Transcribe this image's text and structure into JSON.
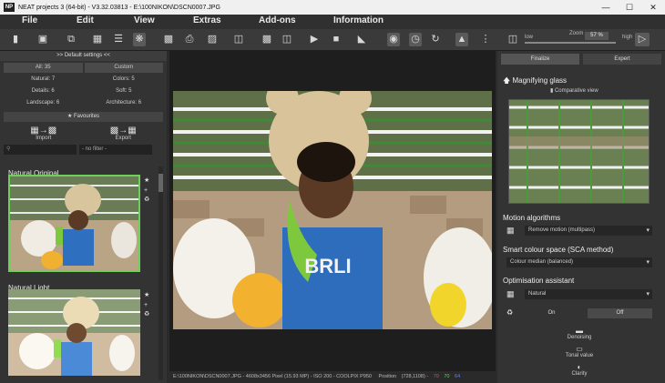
{
  "window": {
    "app_badge": "NP",
    "title": "NEAT projects 3 (64-bit) - V3.32.03813 - E:\\100NIKON\\DSCN0007.JPG",
    "controls": [
      "—",
      "☐",
      "✕"
    ]
  },
  "menu": [
    "File",
    "Edit",
    "View",
    "Extras",
    "Add-ons",
    "Information"
  ],
  "toolbar": {
    "zoom_label": "Zoom",
    "zoom_value": "57 %",
    "zoom_level": 0.57,
    "low_label": "low",
    "high_label": "high"
  },
  "left_panel": {
    "header": ">> Default settings <<",
    "filters": [
      {
        "label": "All: 35",
        "active": true
      },
      {
        "label": "Custom",
        "active": false
      },
      {
        "label": "Natural: 7"
      },
      {
        "label": "Colors: 5"
      },
      {
        "label": "Details: 6"
      },
      {
        "label": "Soft: 5"
      },
      {
        "label": "Landscape: 6"
      },
      {
        "label": "Architecture: 6"
      }
    ],
    "favourites": "★ Favourites",
    "import_label": "Import",
    "export_label": "Export",
    "filter_placeholder": "- no filter -",
    "presets": [
      {
        "name": "Natural Original",
        "selected": true
      },
      {
        "name": "Natural Light",
        "selected": false
      }
    ]
  },
  "status": {
    "text": "E:\\100NIKON\\DSCN0007.JPG - 4608x3456 Pixel (15.93 MP) - ISO 200 - COOLPIX P950",
    "position_label": "Position",
    "position_value": "(728,1108) -",
    "r": "70",
    "g": "70",
    "b": "64"
  },
  "right_panel": {
    "tabs": [
      {
        "label": "Finalize",
        "active": true
      },
      {
        "label": "Expert",
        "active": false
      }
    ],
    "magnifying_title": "Magnifying glass",
    "comparative_view": "Comparative view",
    "motion_title": "Motion algorithms",
    "motion_value": "Remove motion (multipass)",
    "sca_title": "Smart colour space (SCA method)",
    "sca_value": "Colour median (balanced)",
    "optimisation_title": "Optimisation assistant",
    "optimisation_value": "Natural",
    "on_label": "On",
    "off_label": "Off",
    "tools": [
      "Denoising",
      "Tonal value",
      "Clarity"
    ]
  },
  "colors": {
    "accent_green": "#6ed05a",
    "status_r": "#e05050",
    "status_g": "#60d060",
    "status_b": "#6080ff"
  }
}
